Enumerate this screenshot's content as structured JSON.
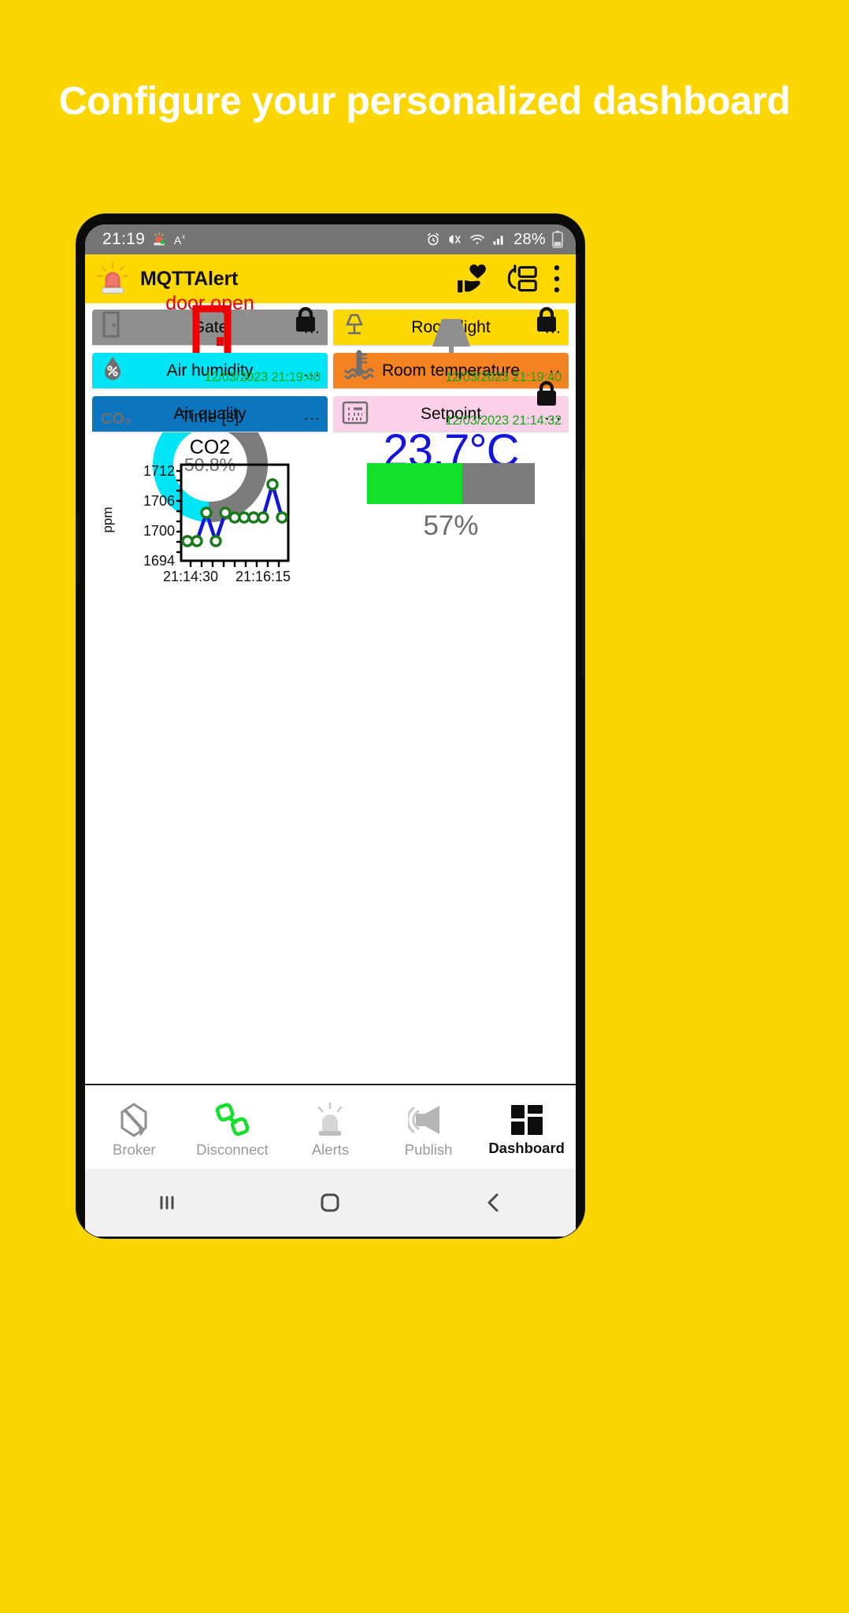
{
  "headline": "Configure your personalized dashboard",
  "statusbar": {
    "time": "21:19",
    "battery_percent": "28%",
    "icons": [
      "siren-notification-icon",
      "font-size-icon",
      "alarm-icon",
      "vibrate-icon",
      "wifi-icon",
      "signal-icon",
      "battery-icon"
    ]
  },
  "appbar": {
    "title": "MQTTAlert",
    "logo_icon": "siren-icon",
    "actions": [
      "donate-hand-heart-icon",
      "refresh-list-icon",
      "overflow-menu-icon"
    ]
  },
  "cards": [
    {
      "title": "Gate",
      "header_color": "#8f8f8f",
      "menu": "...",
      "value_text": "door open",
      "value_color": "#e50000",
      "icon": "door-icon",
      "status_icon": "door-small-icon",
      "locked": true
    },
    {
      "title": "Room light",
      "header_color": "#FFD800",
      "menu": "...",
      "icon": "lamp-icon",
      "status_icon": "lamp-small-icon",
      "locked": true
    },
    {
      "title": "Air humidity",
      "header_color": "#00E5F5",
      "menu": "...",
      "gauge_value": "50.8%",
      "gauge_percent": 50.8,
      "gauge_fill_color": "#00E5F5",
      "gauge_track_color": "#7c7c7c",
      "status_icon": "humidity-drop-icon",
      "timestamp": "12/03/2023 21:19:40"
    },
    {
      "title": "Room temperature",
      "header_color": "#F58220",
      "menu": "··",
      "value_text": "23.7°C",
      "value_color": "#1414dd",
      "status_icon": "thermometer-icon",
      "timestamp": "12/03/2023 21:19:40"
    },
    {
      "title": "Air quality",
      "header_color": "#0B76BE",
      "menu": "...",
      "status_icon": "co2-icon",
      "status_icon_label": "CO₂"
    },
    {
      "title": "Setpoint",
      "header_color": "#FBD0E8",
      "menu": "...",
      "bar_percent": 57,
      "bar_value": "57%",
      "bar_fill_color": "#12e02b",
      "bar_track_color": "#7c7c7c",
      "status_icon": "slider-list-icon",
      "locked": true,
      "timestamp": "12/03/2023 21:14:32"
    }
  ],
  "chart_data": {
    "type": "line",
    "title": "CO2",
    "xlabel": "Time [s]",
    "ylabel": "ppm",
    "ylim": [
      1694,
      1714
    ],
    "yticks": [
      1694,
      1700,
      1706,
      1712
    ],
    "xticks": [
      "21:14:30",
      "21:16:15"
    ],
    "x": [
      0,
      1,
      2,
      3,
      4,
      5,
      6,
      7,
      8,
      9,
      10
    ],
    "values": [
      1698,
      1698,
      1704,
      1698,
      1704,
      1703,
      1703,
      1703,
      1703,
      1710,
      1703
    ],
    "marker": "circle",
    "marker_color": "#1a7a1a",
    "line_color": "#1414dd",
    "grid": false
  },
  "bottom_nav": [
    {
      "label": "Broker",
      "icon": "broker-antenna-icon",
      "active": false
    },
    {
      "label": "Disconnect",
      "icon": "chain-link-icon",
      "active": false
    },
    {
      "label": "Alerts",
      "icon": "siren-alert-icon",
      "active": false
    },
    {
      "label": "Publish",
      "icon": "megaphone-icon",
      "active": false
    },
    {
      "label": "Dashboard",
      "icon": "grid-squares-icon",
      "active": true
    }
  ],
  "system_nav": [
    "recents-icon",
    "home-icon",
    "back-icon"
  ]
}
